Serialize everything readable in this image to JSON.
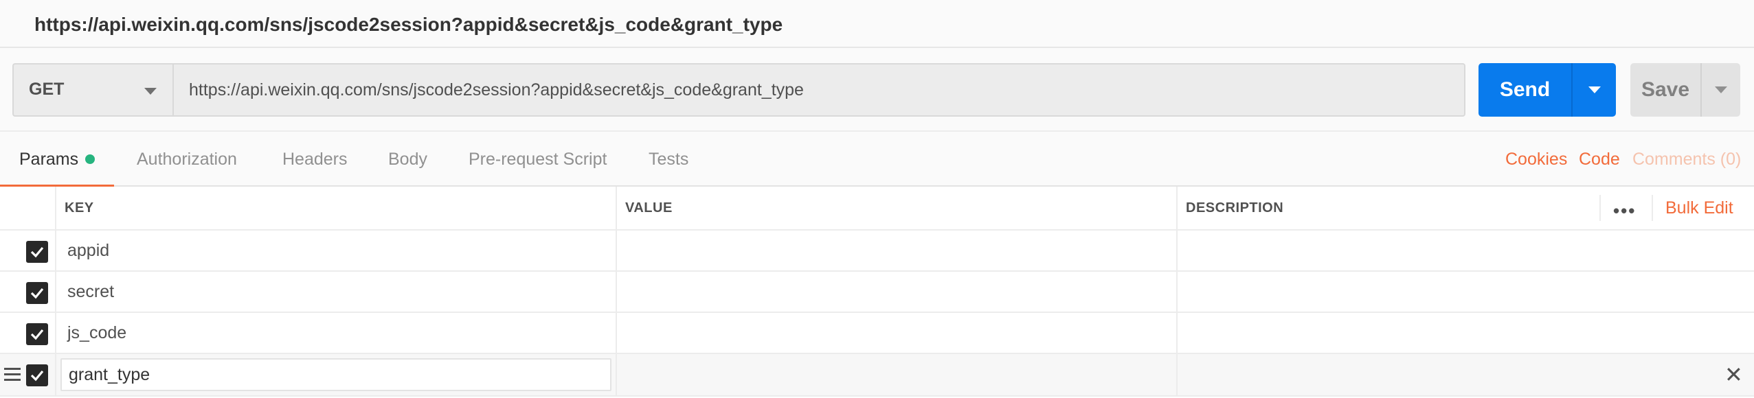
{
  "title_bar": {
    "title": "https://api.weixin.qq.com/sns/jscode2session?appid&secret&js_code&grant_type"
  },
  "request": {
    "method": "GET",
    "url": "https://api.weixin.qq.com/sns/jscode2session?appid&secret&js_code&grant_type",
    "send_label": "Send",
    "save_label": "Save"
  },
  "tabs": [
    {
      "label": "Params",
      "active": true,
      "has_dot": true
    },
    {
      "label": "Authorization"
    },
    {
      "label": "Headers"
    },
    {
      "label": "Body"
    },
    {
      "label": "Pre-request Script"
    },
    {
      "label": "Tests"
    }
  ],
  "right_links": {
    "cookies": "Cookies",
    "code": "Code",
    "comments": "Comments (0)"
  },
  "params_table": {
    "headers": {
      "key": "KEY",
      "value": "VALUE",
      "description": "DESCRIPTION"
    },
    "more_glyph": "•••",
    "bulk_edit": "Bulk Edit",
    "rows": [
      {
        "checked": true,
        "key": "appid",
        "value": "",
        "description": ""
      },
      {
        "checked": true,
        "key": "secret",
        "value": "",
        "description": ""
      },
      {
        "checked": true,
        "key": "js_code",
        "value": "",
        "description": ""
      },
      {
        "checked": true,
        "key": "grant_type",
        "value": "",
        "description": "",
        "editing": true
      }
    ]
  },
  "colors": {
    "accent": "#f26b3a",
    "send_blue": "#097bed",
    "status_dot": "#26b47f",
    "checkbox": "#282828"
  },
  "icons": {
    "method_caret": "chevron-down-icon",
    "send_caret": "chevron-down-icon",
    "save_caret": "chevron-down-icon",
    "checkbox": "check-icon",
    "drag": "drag-handle-icon",
    "remove": "close-icon",
    "more": "more-horizontal-icon"
  },
  "close_glyph": "✕"
}
